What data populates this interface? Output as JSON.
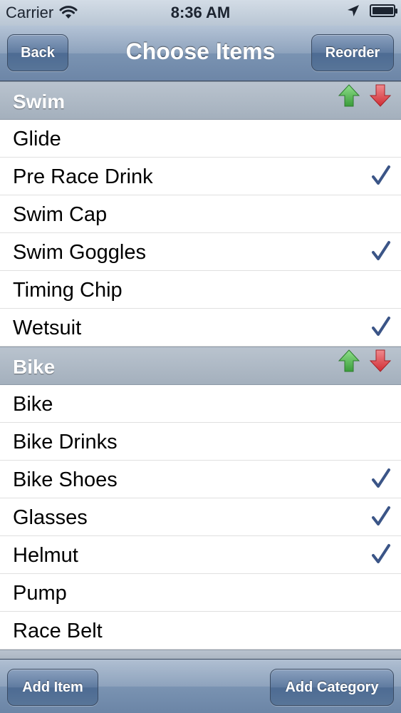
{
  "status_bar": {
    "carrier": "Carrier",
    "time": "8:36 AM",
    "icons": [
      "wifi-icon",
      "location-arrow-icon",
      "battery-icon"
    ]
  },
  "nav": {
    "title": "Choose Items",
    "back_label": "Back",
    "reorder_label": "Reorder"
  },
  "sections": [
    {
      "title": "Swim",
      "items": [
        {
          "label": "Glide",
          "checked": false
        },
        {
          "label": "Pre Race Drink",
          "checked": true
        },
        {
          "label": "Swim Cap",
          "checked": false
        },
        {
          "label": "Swim Goggles",
          "checked": true
        },
        {
          "label": "Timing Chip",
          "checked": false
        },
        {
          "label": "Wetsuit",
          "checked": true
        }
      ]
    },
    {
      "title": "Bike",
      "items": [
        {
          "label": "Bike",
          "checked": false
        },
        {
          "label": "Bike Drinks",
          "checked": false
        },
        {
          "label": "Bike Shoes",
          "checked": true
        },
        {
          "label": "Glasses",
          "checked": true
        },
        {
          "label": "Helmut",
          "checked": true
        },
        {
          "label": "Pump",
          "checked": false
        },
        {
          "label": "Race Belt",
          "checked": false
        }
      ]
    }
  ],
  "toolbar": {
    "add_item_label": "Add Item",
    "add_category_label": "Add Category"
  },
  "colors": {
    "checkmark": "#3b5587",
    "up_arrow": "#5cbf5a",
    "down_arrow": "#e0474c",
    "nav_tint": "#7a93b2"
  }
}
